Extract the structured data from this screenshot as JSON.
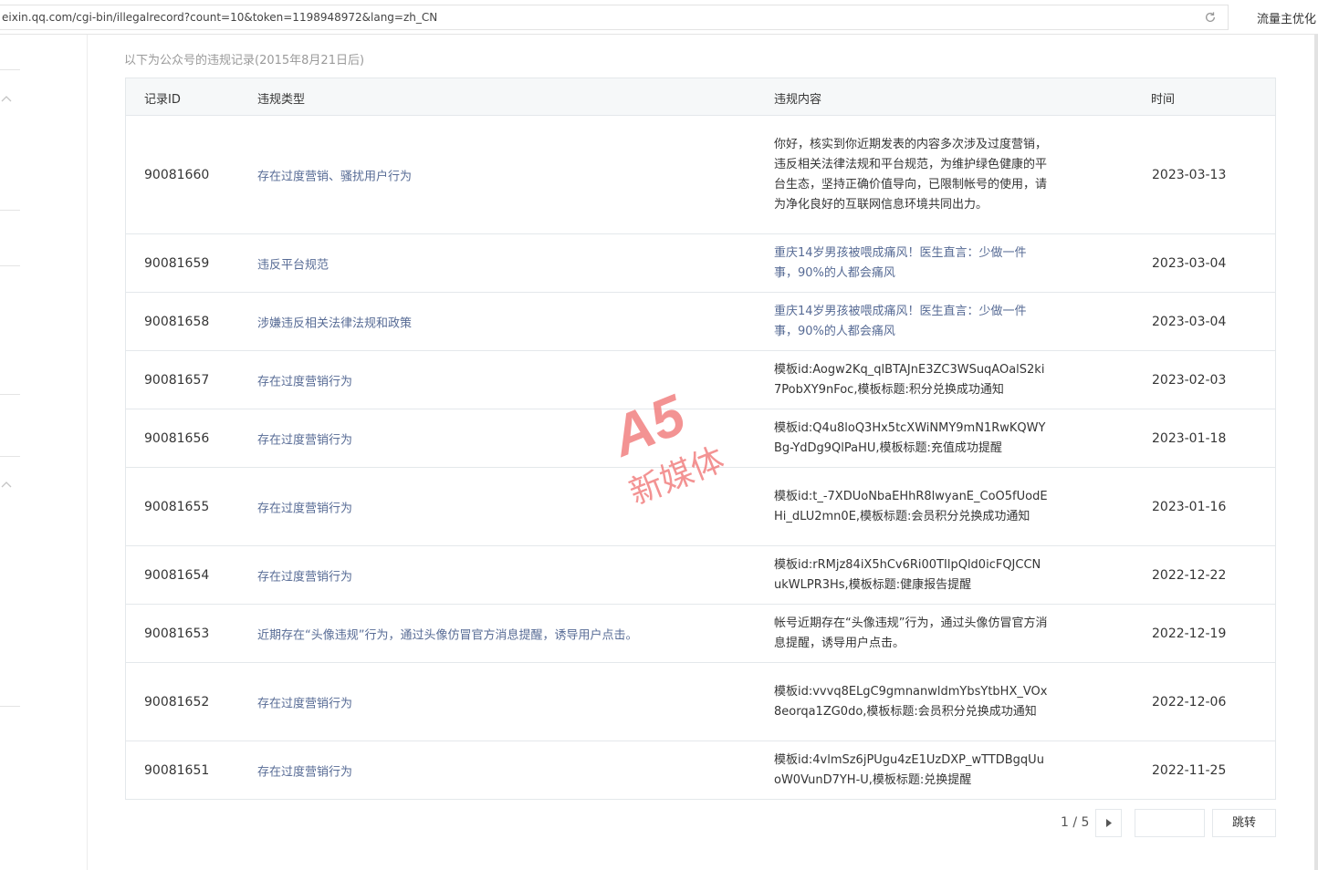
{
  "browser": {
    "url": "eixin.qq.com/cgi-bin/illegalrecord?count=10&token=1198948972&lang=zh_CN",
    "extension_label": "流量主优化"
  },
  "notice": "以下为公众号的违规记录(2015年8月21日后)",
  "table": {
    "headers": {
      "id": "记录ID",
      "type": "违规类型",
      "content": "违规内容",
      "time": "时间"
    },
    "rows": [
      {
        "id": "90081660",
        "type": "存在过度营销、骚扰用户行为",
        "content": "你好，核实到你近期发表的内容多次涉及过度营销，违反相关法律法规和平台规范，为维护绿色健康的平台生态，坚持正确价值导向，已限制帐号的使用，请为净化良好的互联网信息环境共同出力。",
        "time": "2023-03-13"
      },
      {
        "id": "90081659",
        "type": "违反平台规范",
        "content": "重庆14岁男孩被喂成痛风！医生直言：少做一件事，90%的人都会痛风",
        "time": "2023-03-04"
      },
      {
        "id": "90081658",
        "type": "涉嫌违反相关法律法规和政策",
        "content": "重庆14岁男孩被喂成痛风！医生直言：少做一件事，90%的人都会痛风",
        "time": "2023-03-04"
      },
      {
        "id": "90081657",
        "type": "存在过度营销行为",
        "content": "模板id:Aogw2Kq_qlBTAJnE3ZC3WSuqAOalS2ki7PobXY9nFoc,模板标题:积分兑换成功通知",
        "time": "2023-02-03"
      },
      {
        "id": "90081656",
        "type": "存在过度营销行为",
        "content": "模板id:Q4u8loQ3Hx5tcXWiNMY9mN1RwKQWYBg-YdDg9QlPaHU,模板标题:充值成功提醒",
        "time": "2023-01-18"
      },
      {
        "id": "90081655",
        "type": "存在过度营销行为",
        "content": "模板id:t_-7XDUoNbaEHhR8lwyanE_CoO5fUodEHi_dLU2mn0E,模板标题:会员积分兑换成功通知",
        "time": "2023-01-16"
      },
      {
        "id": "90081654",
        "type": "存在过度营销行为",
        "content": "模板id:rRMjz84iX5hCv6Ri00TIlpQld0icFQJCCNukWLPR3Hs,模板标题:健康报告提醒",
        "time": "2022-12-22"
      },
      {
        "id": "90081653",
        "type": "近期存在“头像违规”行为，通过头像仿冒官方消息提醒，诱导用户点击。",
        "content": "帐号近期存在“头像违规”行为，通过头像仿冒官方消息提醒，诱导用户点击。",
        "time": "2022-12-19"
      },
      {
        "id": "90081652",
        "type": "存在过度营销行为",
        "content": "模板id:vvvq8ELgC9gmnanwldmYbsYtbHX_VOx8eorqa1ZG0do,模板标题:会员积分兑换成功通知",
        "time": "2022-12-06"
      },
      {
        "id": "90081651",
        "type": "存在过度营销行为",
        "content": "模板id:4vlmSz6jPUgu4zE1UzDXP_wTTDBgqUuoW0VunD7YH-U,模板标题:兑换提醒",
        "time": "2022-11-25"
      }
    ]
  },
  "pagination": {
    "indicator": "1 / 5",
    "jump_label": "跳转",
    "jump_value": ""
  },
  "watermark": {
    "logo": "A5",
    "text": "新媒体",
    "color": "#f07070"
  },
  "icons": {
    "reload": "reload-icon",
    "next": "chevron-right-icon",
    "collapse": "chevron-up-icon"
  }
}
